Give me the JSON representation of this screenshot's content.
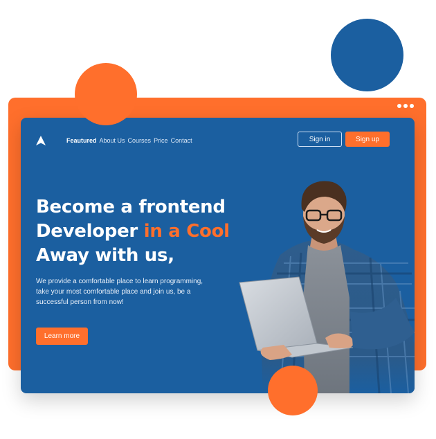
{
  "nav": {
    "items": [
      {
        "label": "Feautured",
        "active": true
      },
      {
        "label": "About Us",
        "active": false
      },
      {
        "label": "Courses",
        "active": false
      },
      {
        "label": "Price",
        "active": false
      },
      {
        "label": "Contact",
        "active": false
      }
    ],
    "signin_label": "Sign in",
    "signup_label": "Sign up"
  },
  "hero": {
    "title_line1": "Become a frontend",
    "title_line2_a": "Developer ",
    "title_line2_b": "in a Cool",
    "title_line3": "Away with us,",
    "description": "We provide a comfortable place to learn programming, take your most comfortable place and join us, be a successful person from now!",
    "cta_label": "Learn more",
    "image": "man-with-laptop-photo"
  },
  "icons": {
    "logo": "logo-a-icon",
    "window_dots": "more-dots-icon"
  },
  "colors": {
    "primary_blue": "#1b5fa0",
    "accent_orange": "#ff6f2c",
    "white": "#ffffff"
  }
}
